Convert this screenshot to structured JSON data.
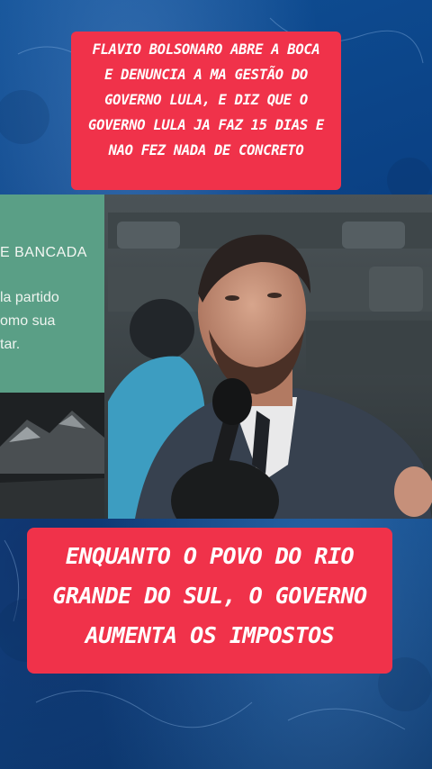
{
  "captions": {
    "top": "FLAVIO BOLSONARO ABRE A BOCA\nE DENUNCIA A MA GESTÃO DO\nGOVERNO LULA, E DIZ QUE O\nGOVERNO LULA JA FAZ 15 DIAS E\nNAO FEZ NADA DE CONCRETO",
    "bottom": "ENQUANTO O POVO DO RIO\nGRANDE DO SUL, O GOVERNO\nAUMENTA OS IMPOSTOS"
  },
  "video": {
    "panel_heading": "E BANCADA",
    "panel_lines": [
      "la partido",
      "omo sua",
      "tar."
    ]
  },
  "colors": {
    "caption_bg": "#f0324a",
    "caption_text": "#ffffff",
    "background_blue": "#0b3d78",
    "panel_green": "#5a9f86"
  }
}
